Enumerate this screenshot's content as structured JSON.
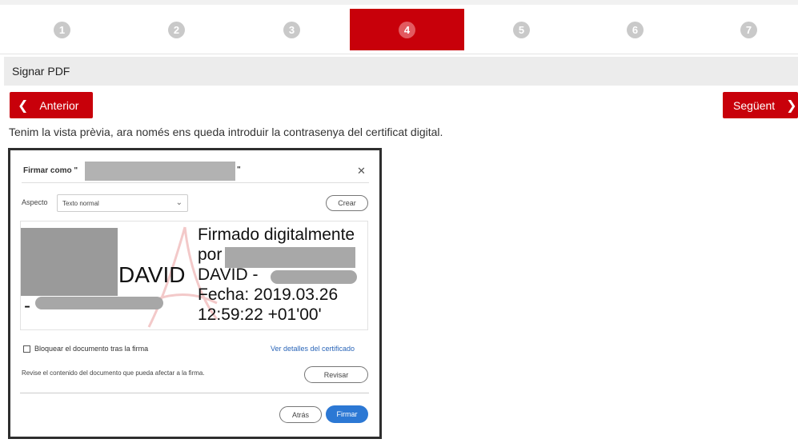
{
  "stepper": {
    "steps": [
      "1",
      "2",
      "3",
      "4",
      "5",
      "6",
      "7"
    ],
    "active_step": "4",
    "colors": {
      "active": "#c8000a",
      "inactive_badge": "#c9c9c9"
    }
  },
  "section": {
    "title": "Signar PDF"
  },
  "nav": {
    "prev_label": "Anterior",
    "prev_icon": "chevron-left-icon",
    "next_label": "Següent",
    "next_icon": "chevron-right-icon"
  },
  "instructions": "Tenim la vista prèvia, ara només ens queda introduir la contrasenya del certificat digital.",
  "dialog": {
    "title": "Firmar como \"",
    "title_end": "\"",
    "close_icon": "close-icon",
    "aspect_label": "Aspecto",
    "aspect_value": "Texto normal",
    "create_label": "Crear",
    "signature": {
      "name_left": "DAVID",
      "dash": "-",
      "text": "Firmado digitalmente\npor\nDAVID -\nFecha: 2019.03.26\n12:59:22 +01'00'"
    },
    "lock_label": "Bloquear el documento tras la firma",
    "details_link": "Ver detalles del certificado",
    "review_text": "Revise el contenido del documento que pueda afectar a la firma.",
    "review_label": "Revisar",
    "back_label": "Atrás",
    "sign_label": "Firmar",
    "colors": {
      "link": "#2a65b8",
      "primary": "#2c78d4"
    }
  }
}
